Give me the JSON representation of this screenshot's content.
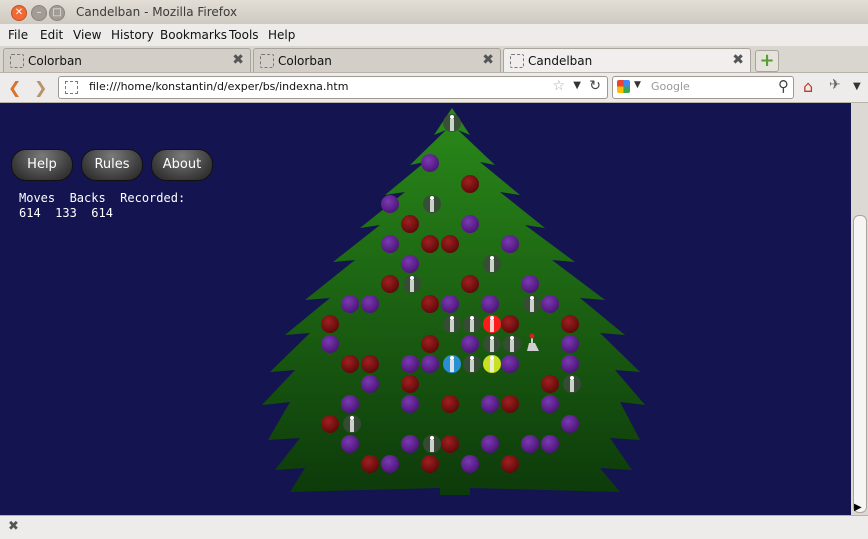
{
  "window": {
    "title": "Candelban - Mozilla Firefox"
  },
  "menubar": [
    "File",
    "Edit",
    "View",
    "History",
    "Bookmarks",
    "Tools",
    "Help"
  ],
  "tabs": [
    {
      "label": "Colorban",
      "active": false
    },
    {
      "label": "Colorban",
      "active": false
    },
    {
      "label": "Candelban",
      "active": true
    }
  ],
  "navbar": {
    "url": "file:///home/konstantin/d/exper/bs/indexna.htm",
    "search_placeholder": "Google"
  },
  "game": {
    "buttons": {
      "help": "Help",
      "rules": "Rules",
      "about": "About"
    },
    "stats": {
      "header": "Moves  Backs  Recorded:",
      "values": "614  133  614"
    },
    "colors": {
      "background": "#141450",
      "tree": "#1a7a12",
      "purple_ball": "#5a1a8c",
      "red_ball": "#7a1010"
    },
    "balls": [
      [
        "p",
        430,
        163
      ],
      [
        "r",
        470,
        184
      ],
      [
        "p",
        390,
        204
      ],
      [
        "r",
        410,
        224
      ],
      [
        "p",
        470,
        224
      ],
      [
        "r",
        430,
        244
      ],
      [
        "r",
        450,
        244
      ],
      [
        "p",
        390,
        244
      ],
      [
        "p",
        510,
        244
      ],
      [
        "p",
        410,
        264
      ],
      [
        "r",
        390,
        284
      ],
      [
        "r",
        470,
        284
      ],
      [
        "p",
        530,
        284
      ],
      [
        "p",
        350,
        304
      ],
      [
        "p",
        370,
        304
      ],
      [
        "r",
        430,
        304
      ],
      [
        "p",
        450,
        304
      ],
      [
        "p",
        490,
        304
      ],
      [
        "p",
        550,
        304
      ],
      [
        "r",
        330,
        324
      ],
      [
        "r",
        510,
        324
      ],
      [
        "r",
        570,
        324
      ],
      [
        "p",
        330,
        344
      ],
      [
        "r",
        430,
        344
      ],
      [
        "p",
        470,
        344
      ],
      [
        "p",
        570,
        344
      ],
      [
        "r",
        350,
        364
      ],
      [
        "r",
        370,
        364
      ],
      [
        "p",
        410,
        364
      ],
      [
        "p",
        430,
        364
      ],
      [
        "p",
        510,
        364
      ],
      [
        "p",
        570,
        364
      ],
      [
        "p",
        370,
        384
      ],
      [
        "r",
        410,
        384
      ],
      [
        "r",
        550,
        384
      ],
      [
        "p",
        350,
        404
      ],
      [
        "p",
        410,
        404
      ],
      [
        "r",
        450,
        404
      ],
      [
        "p",
        490,
        404
      ],
      [
        "r",
        510,
        404
      ],
      [
        "p",
        550,
        404
      ],
      [
        "r",
        330,
        424
      ],
      [
        "p",
        570,
        424
      ],
      [
        "p",
        350,
        444
      ],
      [
        "p",
        410,
        444
      ],
      [
        "r",
        450,
        444
      ],
      [
        "p",
        490,
        444
      ],
      [
        "p",
        530,
        444
      ],
      [
        "p",
        550,
        444
      ],
      [
        "r",
        370,
        464
      ],
      [
        "p",
        390,
        464
      ],
      [
        "r",
        430,
        464
      ],
      [
        "p",
        470,
        464
      ],
      [
        "r",
        510,
        464
      ]
    ],
    "candles": [
      [
        "w",
        452,
        123
      ],
      [
        "w",
        432,
        204
      ],
      [
        "w",
        492,
        264
      ],
      [
        "w",
        412,
        284
      ],
      [
        "w",
        532,
        304
      ],
      [
        "w",
        452,
        324
      ],
      [
        "w",
        472,
        324
      ],
      [
        "w",
        492,
        344
      ],
      [
        "w",
        512,
        344
      ],
      [
        "w",
        472,
        364
      ],
      [
        "w",
        572,
        384
      ],
      [
        "w",
        352,
        424
      ],
      [
        "w",
        432,
        444
      ],
      [
        "b",
        452,
        364
      ],
      [
        "y",
        492,
        364
      ],
      [
        "rr",
        492,
        324
      ]
    ]
  }
}
